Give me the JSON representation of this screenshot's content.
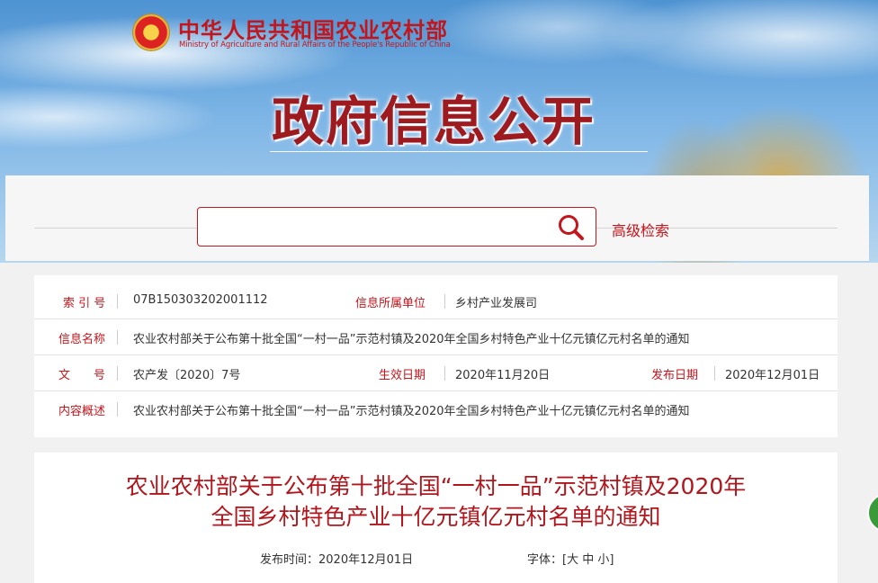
{
  "header": {
    "ministry_cn": "中华人民共和国农业农村部",
    "ministry_en": "Ministry of Agriculture and Rural Affairs of the People's Republic of China",
    "banner_title": "政府信息公开"
  },
  "search": {
    "placeholder": "",
    "advanced_label": "高级检索",
    "icon": "search-icon"
  },
  "info": {
    "index_label": "索 引 号",
    "index_value": "07B150303202001112",
    "owner_label": "信息所属单位",
    "owner_value": "乡村产业发展司",
    "name_label": "信息名称",
    "name_value": "农业农村部关于公布第十批全国“一村一品”示范村镇及2020年全国乡村特色产业十亿元镇亿元村名单的通知",
    "doc_label": "文　　号",
    "doc_value": "农产发〔2020〕7号",
    "effective_label": "生效日期",
    "effective_value": "2020年11月20日",
    "publish_label": "发布日期",
    "publish_value": "2020年12月01日",
    "summary_label": "内容概述",
    "summary_value": "农业农村部关于公布第十批全国“一村一品”示范村镇及2020年全国乡村特色产业十亿元镇亿元村名单的通知"
  },
  "document": {
    "title_line1": "农业农村部关于公布第十批全国“一村一品”示范村镇及2020年",
    "title_line2": "全国乡村特色产业十亿元镇亿元村名单的通知",
    "publish_time": "发布时间：2020年12月01日",
    "font_label": "字体：[",
    "font_large": "大",
    "font_medium": "中",
    "font_small": "小",
    "font_close": "]"
  },
  "colors": {
    "accent": "#c3161c",
    "title_red": "#b0161c"
  }
}
